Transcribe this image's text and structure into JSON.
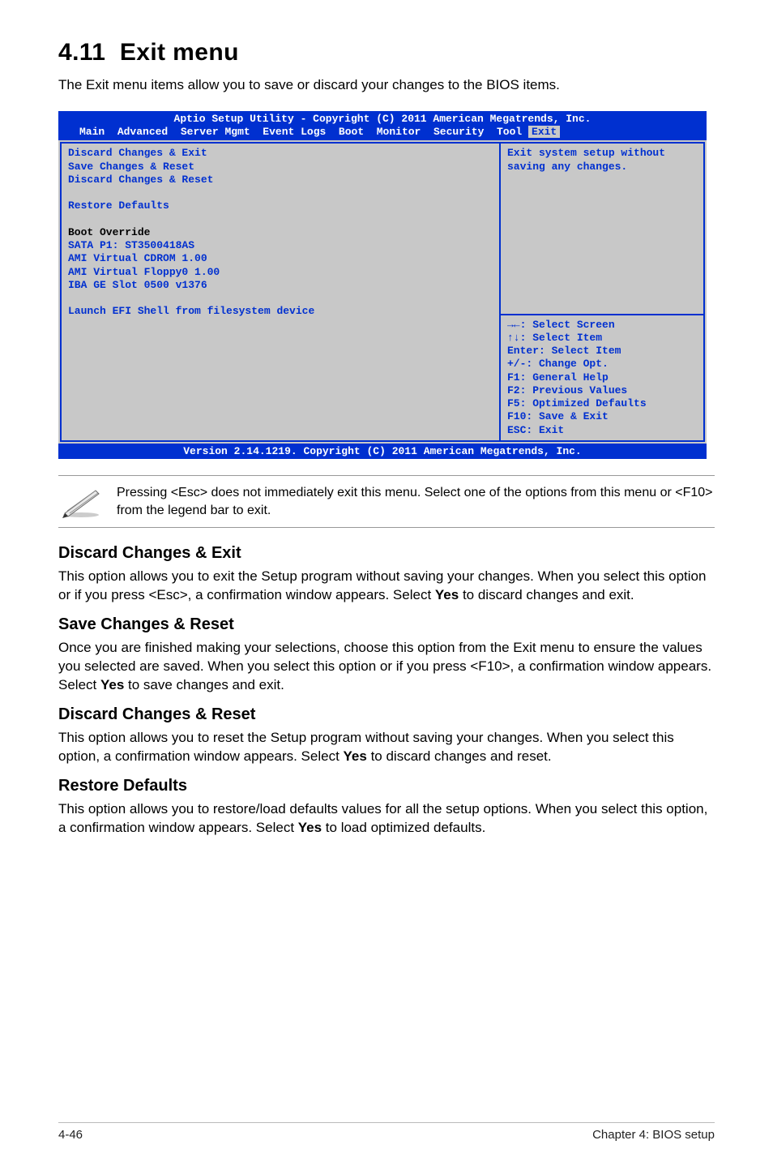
{
  "section_number": "4.11",
  "section_name": "Exit menu",
  "intro": "The Exit menu items allow you to save or discard your changes to the BIOS items.",
  "bios": {
    "header_line1": "Aptio Setup Utility - Copyright (C) 2011 American Megatrends, Inc.",
    "tabs": [
      "Main",
      "Advanced",
      "Server Mgmt",
      "Event Logs",
      "Boot",
      "Monitor",
      "Security",
      "Tool",
      "Exit"
    ],
    "left": {
      "items_block1": [
        "Discard Changes & Exit",
        "Save Changes & Reset",
        "Discard Changes & Reset"
      ],
      "restore": "Restore Defaults",
      "override_heading": "Boot Override",
      "override_items": [
        "SATA P1: ST3500418AS",
        "AMI Virtual CDROM 1.00",
        "AMI Virtual Floppy0 1.00",
        "IBA GE Slot 0500 v1376"
      ],
      "launch": "Launch EFI Shell from filesystem device"
    },
    "right_top": [
      "Exit system setup without",
      "saving any changes."
    ],
    "right_bottom": [
      "→←: Select Screen",
      "↑↓:  Select Item",
      "Enter: Select Item",
      "+/-: Change Opt.",
      "F1: General Help",
      "F2: Previous Values",
      "F5: Optimized Defaults",
      "F10: Save & Exit",
      "ESC: Exit"
    ],
    "footer": "Version 2.14.1219. Copyright (C) 2011 American Megatrends, Inc."
  },
  "note": "Pressing <Esc> does not immediately exit this menu. Select one of the options from this menu or <F10> from the legend bar to exit.",
  "sections": {
    "s1": {
      "title": "Discard Changes & Exit",
      "body_a": "This option allows you to exit the Setup program without saving your changes. When you select this option or if you press <Esc>, a confirmation window appears. Select ",
      "yes": "Yes",
      "body_b": " to discard changes and exit."
    },
    "s2": {
      "title": "Save Changes & Reset",
      "body_a": "Once you are finished making your selections, choose this option from the Exit menu to ensure the values you selected are saved. When you select this option or if you press <F10>, a confirmation window appears. Select ",
      "yes": "Yes",
      "body_b": " to save changes and exit."
    },
    "s3": {
      "title": "Discard Changes & Reset",
      "body_a": "This option allows you to reset the Setup program without saving your changes. When you select this option, a confirmation window appears. Select ",
      "yes": "Yes",
      "body_b": " to discard changes and reset."
    },
    "s4": {
      "title": "Restore Defaults",
      "body_a": "This option allows you to restore/load defaults values for all the setup options. When you select this option, a confirmation window appears. Select ",
      "yes": "Yes",
      "body_b": " to load optimized defaults."
    }
  },
  "footer": {
    "left": "4-46",
    "right": "Chapter 4: BIOS setup"
  }
}
